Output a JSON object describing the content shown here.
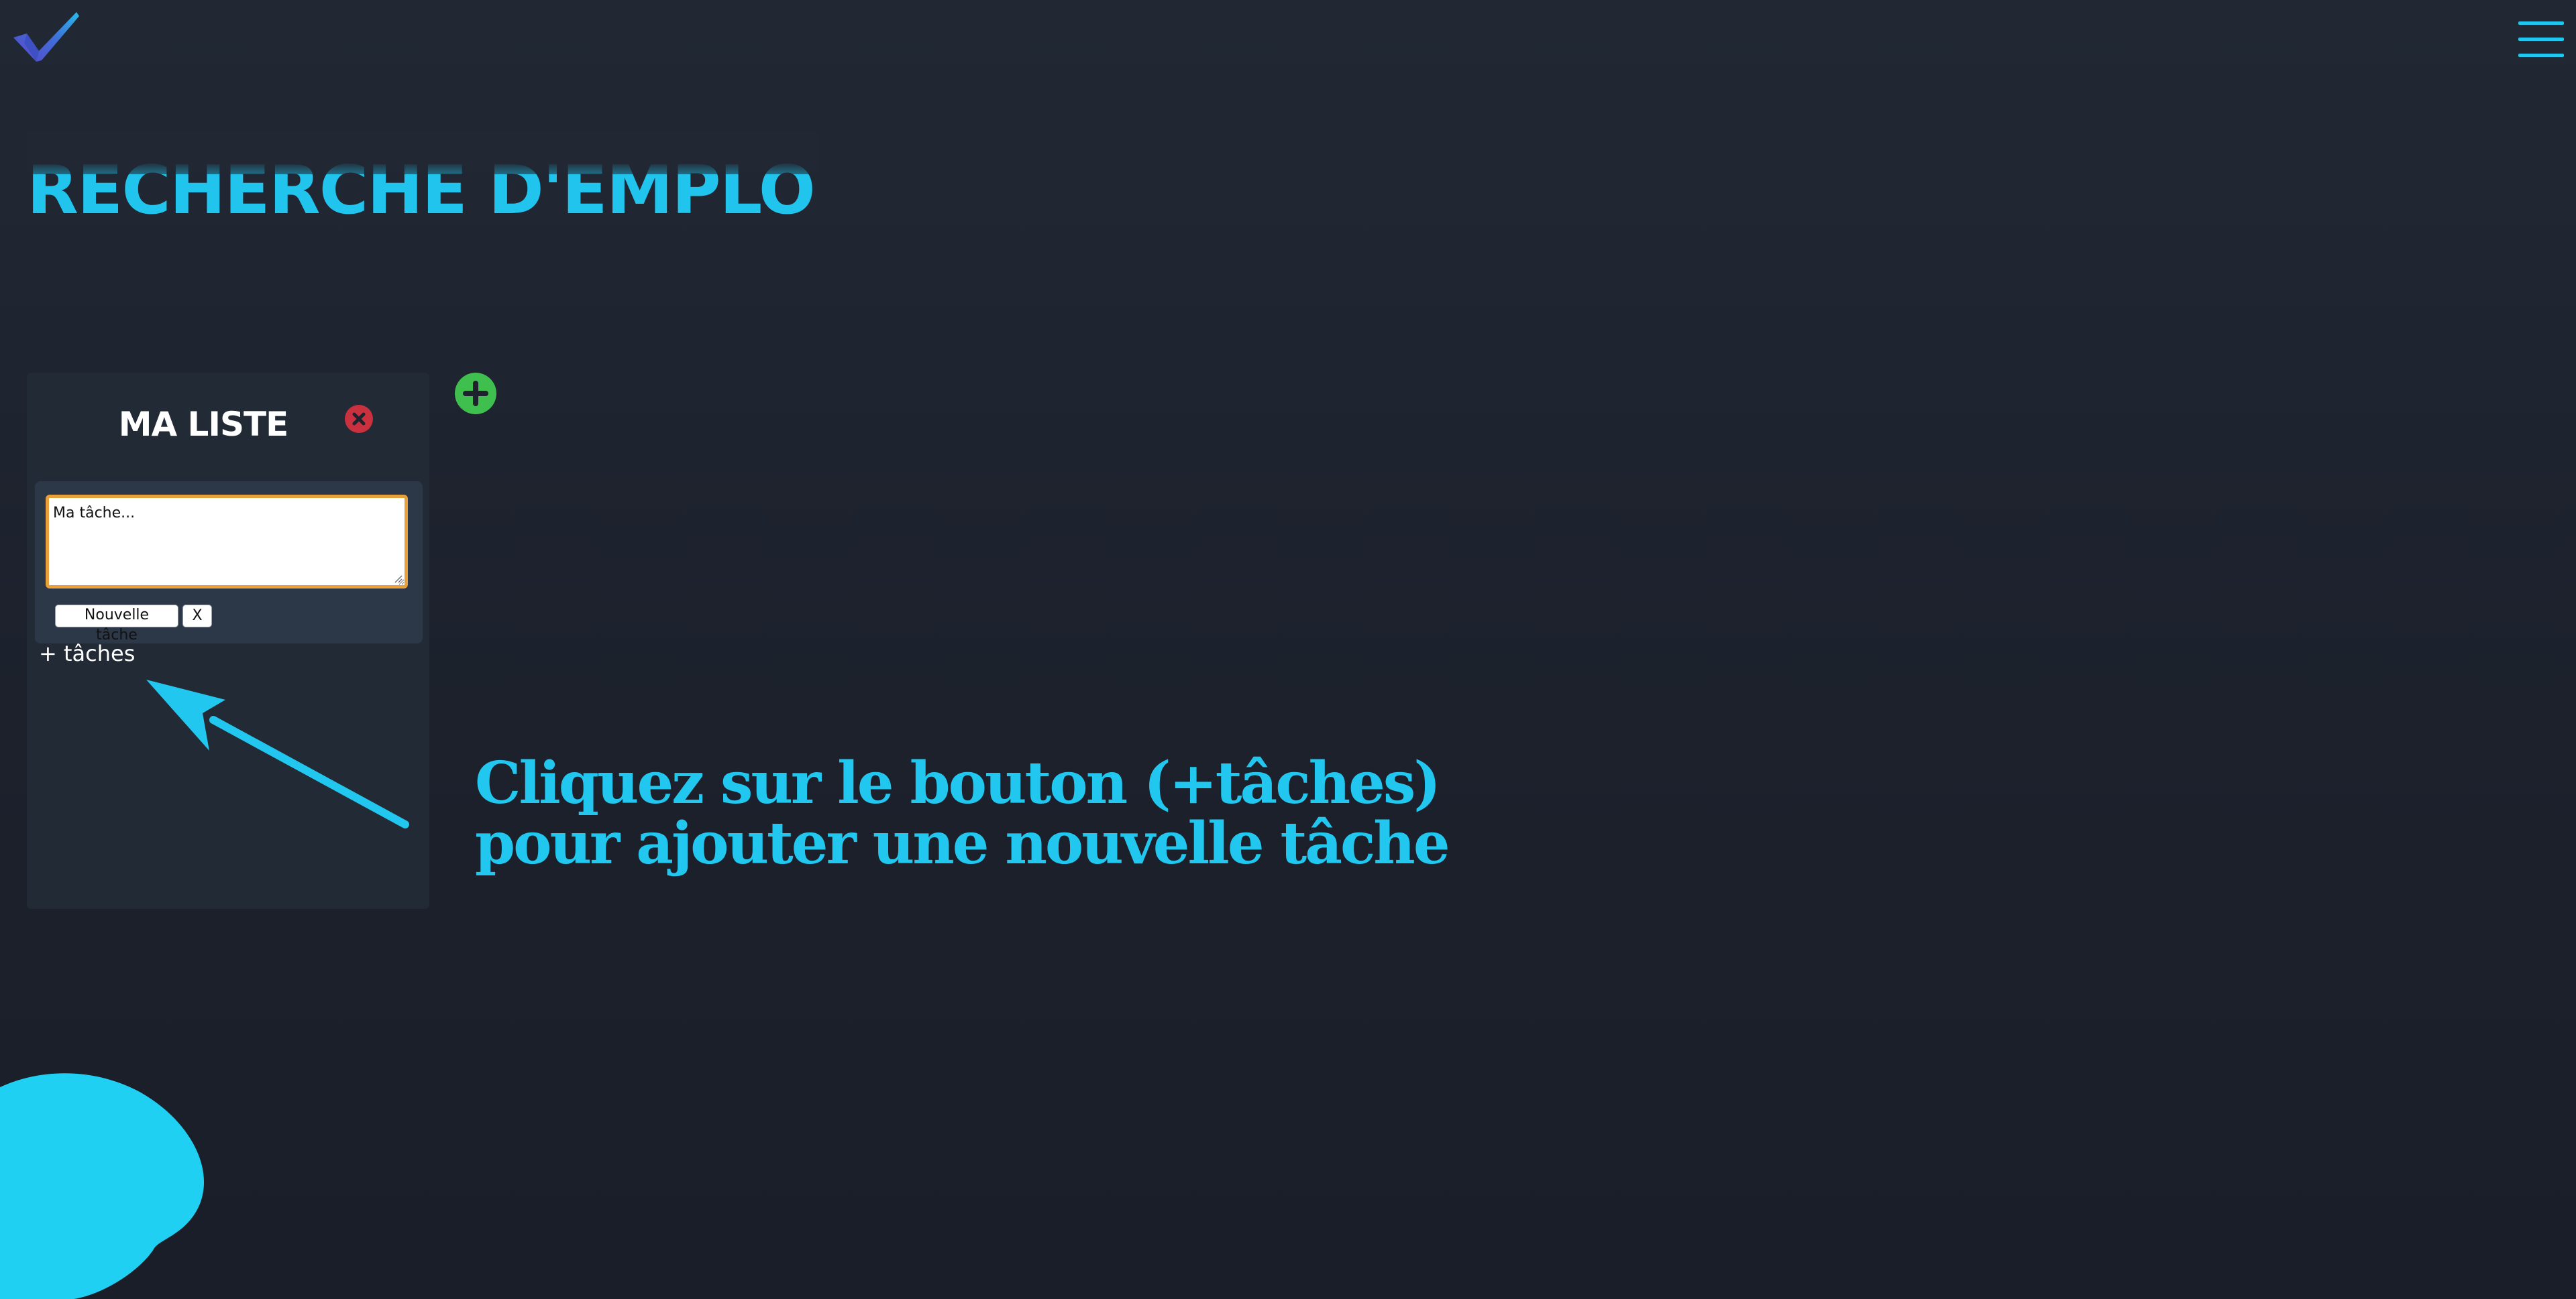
{
  "header": {
    "logo_icon": "checkmark-logo-icon",
    "menu_icon": "hamburger-menu-icon"
  },
  "page": {
    "title": "RECHERCHE D'EMPLOI"
  },
  "list": {
    "title": "MA LISTE",
    "delete_icon": "close-circle-icon",
    "task_input_value": "Ma tâche...",
    "new_task_label": "Nouvelle tâche",
    "cancel_label": "X",
    "add_tasks_label": "+ tâches"
  },
  "add_list": {
    "icon": "plus-circle-icon"
  },
  "hint": {
    "line1": "Cliquez sur le bouton (+tâches)",
    "line2": "pour ajouter une nouvelle tâche",
    "arrow_icon": "arrow-icon"
  },
  "colors": {
    "accent": "#22c7ef",
    "background": "#1d222d",
    "card": "#222a36",
    "form": "#2c3748",
    "danger": "#c9313f",
    "success": "#3fbf4e",
    "input_focus": "#e8a13a"
  }
}
